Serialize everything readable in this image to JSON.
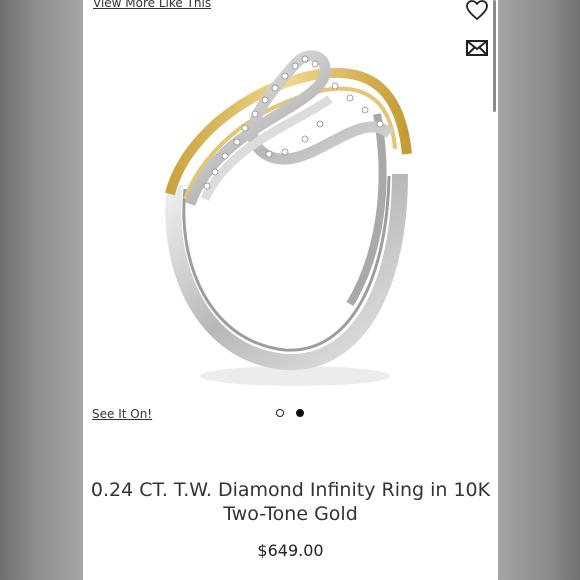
{
  "page": {
    "view_more_link": "View More Like This",
    "see_it_on_link": "See It On!",
    "icons": {
      "favorite": "heart-icon",
      "email": "envelope-icon"
    },
    "carousel": {
      "slide_count": 2,
      "active_index": 2
    }
  },
  "product": {
    "title_line1": "0.24 CT. T.W. Diamond Infinity Ring in 10K",
    "title_line2": "Two-Tone Gold",
    "price": "$649.00"
  },
  "colors": {
    "gold": "#d8b85a",
    "silver": "#c9c9c9",
    "text": "#333333"
  }
}
